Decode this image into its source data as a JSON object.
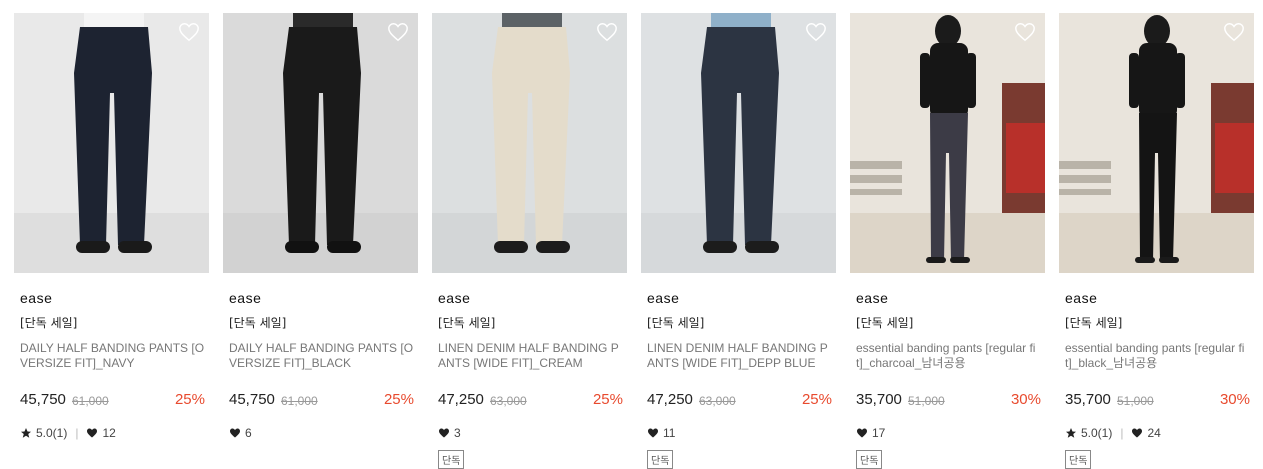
{
  "products": [
    {
      "brand": "ease",
      "tag": "[단독 세일]",
      "name": "DAILY HALF BANDING PANTS [OVERSIZE FIT]_NAVY",
      "price": "45,750",
      "original_price": "61,000",
      "discount": "25%",
      "rating": "5.0(1)",
      "likes": "12",
      "badge": "",
      "colors": {
        "bg": "#e9e9e9",
        "floor": "#dedede",
        "pants": "#1d2331",
        "shirt": "#f4f4f4",
        "shoe": "#1a1a1a"
      }
    },
    {
      "brand": "ease",
      "tag": "[단독 세일]",
      "name": "DAILY HALF BANDING PANTS [OVERSIZE FIT]_BLACK",
      "price": "45,750",
      "original_price": "61,000",
      "discount": "25%",
      "rating": "",
      "likes": "6",
      "badge": "",
      "colors": {
        "bg": "#dadada",
        "floor": "#d2d2d2",
        "pants": "#1a1a1a",
        "shirt": "#2a2a2a",
        "shoe": "#111111"
      }
    },
    {
      "brand": "ease",
      "tag": "[단독 세일]",
      "name": "LINEN DENIM HALF BANDING PANTS [WIDE FIT]_CREAM",
      "price": "47,250",
      "original_price": "63,000",
      "discount": "25%",
      "rating": "",
      "likes": "3",
      "badge": "단독",
      "colors": {
        "bg": "#dcdfe0",
        "floor": "#d3d6d7",
        "pants": "#e4dccb",
        "shirt": "#5c6266",
        "shoe": "#1c1c1c"
      }
    },
    {
      "brand": "ease",
      "tag": "[단독 세일]",
      "name": "LINEN DENIM HALF BANDING PANTS [WIDE FIT]_DEPP BLUE",
      "price": "47,250",
      "original_price": "63,000",
      "discount": "25%",
      "rating": "",
      "likes": "11",
      "badge": "단독",
      "colors": {
        "bg": "#dee1e3",
        "floor": "#d6d9db",
        "pants": "#2c3442",
        "shirt": "#8fb0c9",
        "shoe": "#1c1c1c"
      }
    },
    {
      "brand": "ease",
      "tag": "[단독 세일]",
      "name": "essential banding pants [regular fit]_charcoal_남녀공용",
      "price": "35,700",
      "original_price": "51,000",
      "discount": "30%",
      "rating": "",
      "likes": "17",
      "badge": "단독",
      "colors": {
        "bg": "#e9e4dc",
        "floor": "#ddd5c8",
        "pants": "#3c3b46",
        "shirt": "#161616",
        "shoe": "#1a1a1a"
      }
    },
    {
      "brand": "ease",
      "tag": "[단독 세일]",
      "name": "essential banding pants [regular fit]_black_남녀공용",
      "price": "35,700",
      "original_price": "51,000",
      "discount": "30%",
      "rating": "5.0(1)",
      "likes": "24",
      "badge": "단독",
      "colors": {
        "bg": "#e9e4dc",
        "floor": "#ddd5c8",
        "pants": "#141414",
        "shirt": "#161616",
        "shoe": "#1a1a1a"
      }
    }
  ],
  "icons": {
    "wishlist": "heart-outline-icon",
    "rating": "star-icon",
    "likes": "heart-icon"
  },
  "colors": {
    "discount": "#e84a2e",
    "text": "#222222",
    "muted": "#777777"
  }
}
